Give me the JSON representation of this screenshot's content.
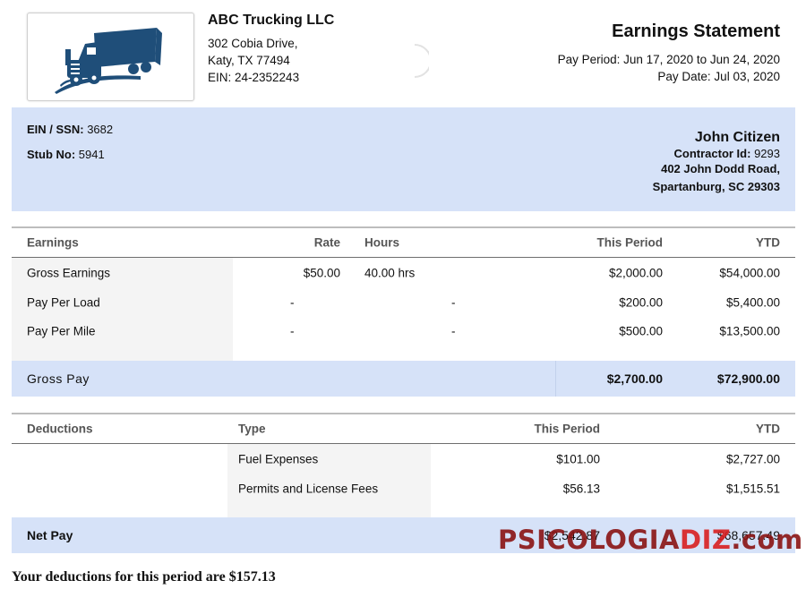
{
  "company": {
    "name": "ABC Trucking LLC",
    "address1": "302 Cobia Drive,",
    "address2": "Katy, TX 77494",
    "ein": "EIN: 24-2352243"
  },
  "statement": {
    "title": "Earnings Statement",
    "pay_period": "Pay Period: Jun 17, 2020 to Jun 24, 2020",
    "pay_date": "Pay Date: Jul 03, 2020"
  },
  "info": {
    "ein_ssn_label": "EIN / SSN:",
    "ein_ssn_value": "3682",
    "stub_label": "Stub No:",
    "stub_value": "5941",
    "contractor_name": "John Citizen",
    "contractor_id_label": "Contractor Id:",
    "contractor_id_value": "9293",
    "address1": "402 John Dodd Road,",
    "address2": "Spartanburg, SC 29303"
  },
  "earnings": {
    "headers": {
      "earnings": "Earnings",
      "rate": "Rate",
      "hours": "Hours",
      "this_period": "This Period",
      "ytd": "YTD"
    },
    "rows": [
      {
        "name": "Gross Earnings",
        "rate": "$50.00",
        "hours": "40.00 hrs",
        "this_period": "$2,000.00",
        "ytd": "$54,000.00"
      },
      {
        "name": "Pay Per Load",
        "rate": "-",
        "hours": "-",
        "this_period": "$200.00",
        "ytd": "$5,400.00"
      },
      {
        "name": "Pay Per Mile",
        "rate": "-",
        "hours": "-",
        "this_period": "$500.00",
        "ytd": "$13,500.00"
      }
    ],
    "total_label": "Gross Pay",
    "total_this_period": "$2,700.00",
    "total_ytd": "$72,900.00"
  },
  "deductions": {
    "headers": {
      "deductions": "Deductions",
      "type": "Type",
      "this_period": "This Period",
      "ytd": "YTD"
    },
    "rows": [
      {
        "type": "Fuel Expenses",
        "this_period": "$101.00",
        "ytd": "$2,727.00"
      },
      {
        "type": "Permits and License Fees",
        "this_period": "$56.13",
        "ytd": "$1,515.51"
      }
    ],
    "net_label": "Net Pay",
    "net_this_period": "$2,542.87",
    "net_ytd": "$68,657.49"
  },
  "note": "Your deductions for this period are $157.13",
  "watermark": {
    "part1": "PSICOLOGIA",
    "part2": "DIZ",
    "part3": ".com"
  },
  "colors": {
    "band": "#d6e2f8",
    "truck": "#1f4e79"
  }
}
